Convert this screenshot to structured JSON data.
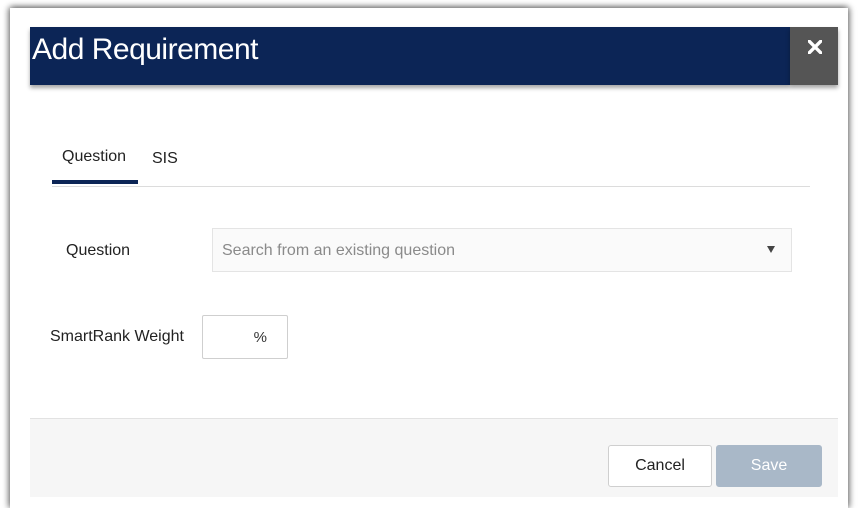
{
  "dialog": {
    "title": "Add Requirement",
    "close_icon": "close-icon"
  },
  "tabs": [
    {
      "label": "Question",
      "active": true
    },
    {
      "label": "SIS",
      "active": false
    }
  ],
  "form": {
    "question": {
      "label": "Question",
      "placeholder": "Search from an existing question"
    },
    "smartrank": {
      "label": "SmartRank Weight",
      "value": "",
      "unit": "%"
    }
  },
  "footer": {
    "cancel_label": "Cancel",
    "save_label": "Save"
  },
  "colors": {
    "header": "#0c2556",
    "close_box": "#555555",
    "save_disabled": "#a9b8c8"
  }
}
